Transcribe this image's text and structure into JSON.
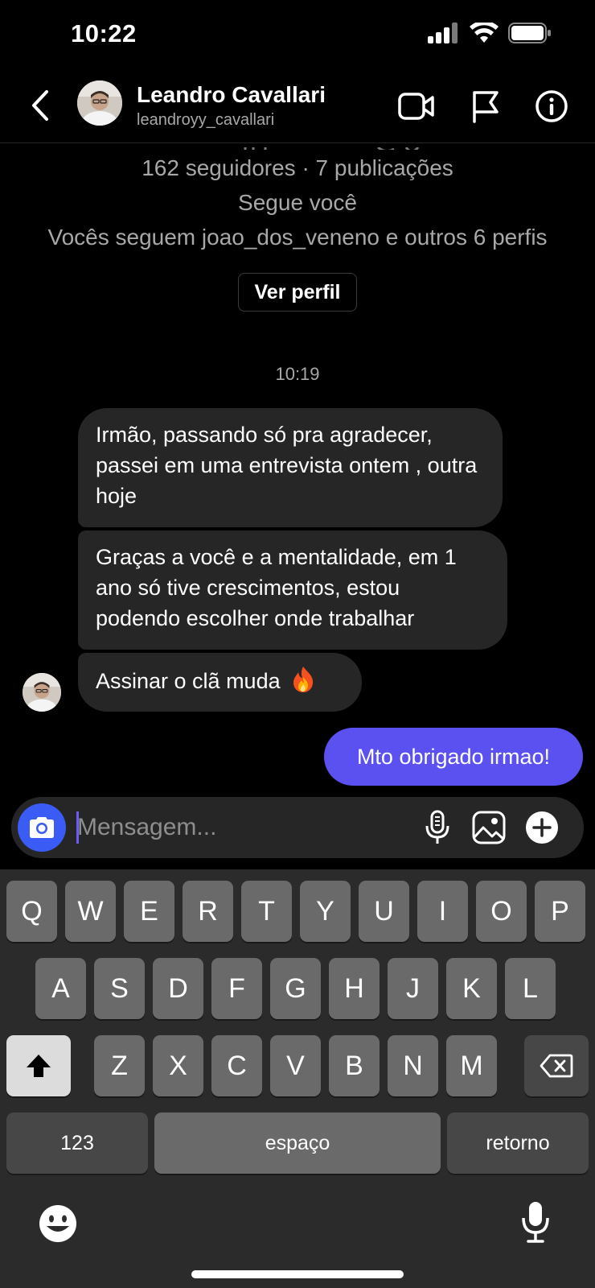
{
  "status_bar": {
    "time": "10:22"
  },
  "header": {
    "name": "Leandro Cavallari",
    "username": "leandroyy_cavallari",
    "icons": [
      "back-icon",
      "video-call-icon",
      "report-flag-icon",
      "info-icon"
    ]
  },
  "profile": {
    "stats": "162 seguidores · 7 publicações",
    "follows_you": "Segue você",
    "mutual": "Vocês seguem joao_dos_veneno e outros 6 perfis",
    "view_profile_label": "Ver perfil"
  },
  "conversation": {
    "timestamp": "10:19",
    "received": [
      "Irmão, passando só pra agradecer, passei em uma entrevista ontem , outra hoje",
      "Graças a você e a mentalidade, em 1 ano só tive crescimentos, estou podendo escolher onde trabalhar",
      "Assinar o clã muda"
    ],
    "received_last_emoji": "fire-emoji",
    "sent": "Mto obrigado irmao!"
  },
  "composer": {
    "placeholder": "Mensagem...",
    "icons": [
      "camera-icon",
      "microphone-icon",
      "gallery-icon",
      "plus-icon"
    ]
  },
  "keyboard": {
    "row1": [
      "Q",
      "W",
      "E",
      "R",
      "T",
      "Y",
      "U",
      "I",
      "O",
      "P"
    ],
    "row2": [
      "A",
      "S",
      "D",
      "F",
      "G",
      "H",
      "J",
      "K",
      "L"
    ],
    "row3": [
      "Z",
      "X",
      "C",
      "V",
      "B",
      "N",
      "M"
    ],
    "numbers_label": "123",
    "space_label": "espaço",
    "return_label": "retorno"
  },
  "colors": {
    "background": "#000000",
    "bubble_received": "#262626",
    "bubble_sent": "#5b50f0",
    "camera_button": "#3b5bf5"
  }
}
